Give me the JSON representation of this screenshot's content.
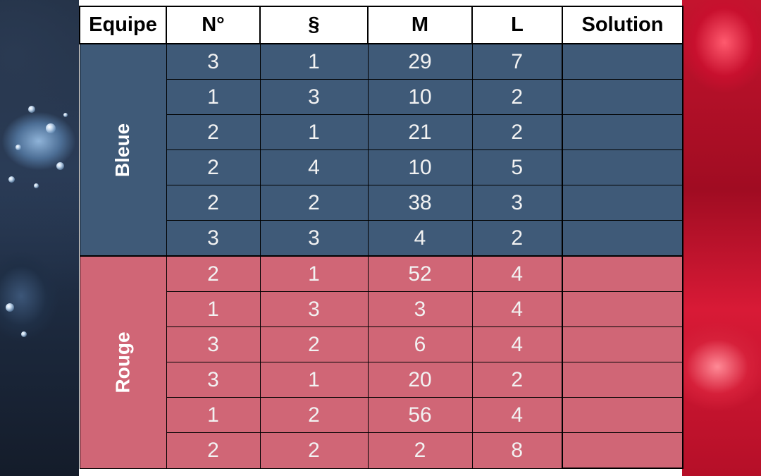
{
  "headers": {
    "team": "Equipe",
    "number": "N°",
    "section": "§",
    "m": "M",
    "l": "L",
    "solution": "Solution"
  },
  "groups": [
    {
      "label": "Bleue",
      "color": "#3f5a78",
      "rows": [
        {
          "n": "3",
          "s": "1",
          "m": "29",
          "l": "7",
          "solution": ""
        },
        {
          "n": "1",
          "s": "3",
          "m": "10",
          "l": "2",
          "solution": ""
        },
        {
          "n": "2",
          "s": "1",
          "m": "21",
          "l": "2",
          "solution": ""
        },
        {
          "n": "2",
          "s": "4",
          "m": "10",
          "l": "5",
          "solution": ""
        },
        {
          "n": "2",
          "s": "2",
          "m": "38",
          "l": "3",
          "solution": ""
        },
        {
          "n": "3",
          "s": "3",
          "m": "4",
          "l": "2",
          "solution": ""
        }
      ]
    },
    {
      "label": "Rouge",
      "color": "#d06676",
      "rows": [
        {
          "n": "2",
          "s": "1",
          "m": "52",
          "l": "4",
          "solution": ""
        },
        {
          "n": "1",
          "s": "3",
          "m": "3",
          "l": "4",
          "solution": ""
        },
        {
          "n": "3",
          "s": "2",
          "m": "6",
          "l": "4",
          "solution": ""
        },
        {
          "n": "3",
          "s": "1",
          "m": "20",
          "l": "2",
          "solution": ""
        },
        {
          "n": "1",
          "s": "2",
          "m": "56",
          "l": "4",
          "solution": ""
        },
        {
          "n": "2",
          "s": "2",
          "m": "2",
          "l": "8",
          "solution": ""
        }
      ]
    }
  ]
}
